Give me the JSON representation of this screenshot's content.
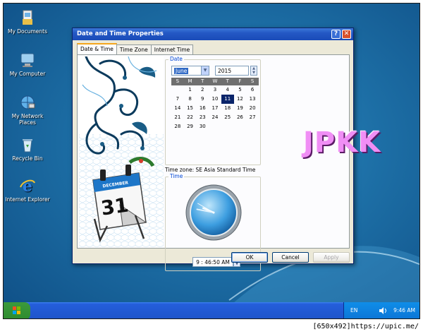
{
  "desktop": {
    "icons": [
      {
        "label": "My Documents",
        "icon": "my-documents-icon"
      },
      {
        "label": "My Computer",
        "icon": "my-computer-icon"
      },
      {
        "label": "My Network Places",
        "icon": "network-places-icon"
      },
      {
        "label": "Recycle Bin",
        "icon": "recycle-bin-icon"
      },
      {
        "label": "Internet Explorer",
        "icon": "internet-explorer-icon"
      }
    ],
    "watermark": "JPKK"
  },
  "dialog": {
    "title": "Date and Time Properties",
    "help_glyph": "?",
    "close_glyph": "✕",
    "tabs": [
      {
        "label": "Date & Time",
        "active": true
      },
      {
        "label": "Time Zone",
        "active": false
      },
      {
        "label": "Internet Time",
        "active": false
      }
    ],
    "date": {
      "group_label": "Date",
      "month": "June",
      "year": "2015",
      "weekday_headers": [
        "S",
        "M",
        "T",
        "W",
        "T",
        "F",
        "S"
      ],
      "leading_blanks": 1,
      "days": [
        "1",
        "2",
        "3",
        "4",
        "5",
        "6",
        "7",
        "8",
        "9",
        "10",
        "11",
        "12",
        "13",
        "14",
        "15",
        "16",
        "17",
        "18",
        "19",
        "20",
        "21",
        "22",
        "23",
        "24",
        "25",
        "26",
        "27",
        "28",
        "29",
        "30"
      ],
      "selected_day": "11"
    },
    "timezone_text": "Time zone:  SE Asia Standard Time",
    "time": {
      "group_label": "Time",
      "value": "9 : 46:50 AM",
      "hour": 9,
      "minute": 46,
      "second": 50
    },
    "calendar_art": {
      "month": "DECEMBER",
      "day": "31"
    },
    "buttons": {
      "ok": "OK",
      "cancel": "Cancel",
      "apply": "Apply"
    }
  },
  "taskbar": {
    "language": "EN",
    "clock": "9:46 AM"
  },
  "footer": "[650x492]https://upic.me/",
  "colors": {
    "desktop": "#1d6fa6",
    "titlebar": "#2458c4",
    "watermark": "#f08ef5",
    "taskbar": "#245edb"
  }
}
